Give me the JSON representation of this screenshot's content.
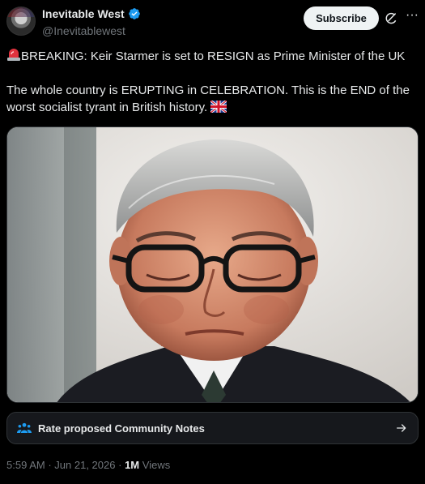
{
  "author": {
    "display_name": "Inevitable West",
    "handle": "@Inevitablewest"
  },
  "header": {
    "subscribe_label": "Subscribe"
  },
  "tweet": {
    "line1": "BREAKING: Keir Starmer is set to RESIGN as Prime Minister of the UK",
    "line2": "The whole country is ERUPTING in CELEBRATION. This is the END of the worst socialist tyrant in British history.",
    "image_alt": "Photo of a man in glasses looking down"
  },
  "community_notes": {
    "label": "Rate proposed Community Notes"
  },
  "meta": {
    "time": "5:59 AM",
    "separator1": "·",
    "date": "Jun 21, 2026",
    "separator2": "·",
    "views_count": "1M",
    "views_label": "Views"
  },
  "colors": {
    "background": "#000000",
    "text": "#e7e9ea",
    "muted": "#71767b",
    "verified": "#1d9bf0",
    "border": "#2f3336"
  }
}
